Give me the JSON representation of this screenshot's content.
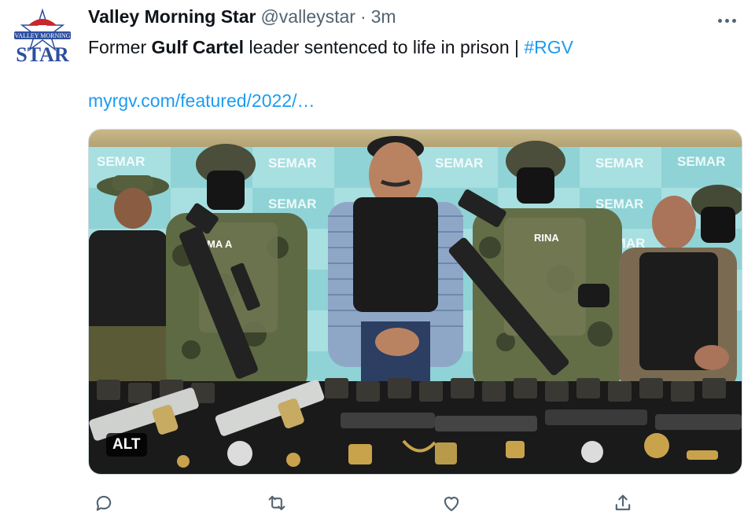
{
  "tweet": {
    "display_name": "Valley Morning Star",
    "handle": "@valleystar",
    "separator": "·",
    "time": "3m",
    "text_before": "Former ",
    "text_bold": "Gulf Cartel",
    "text_after": " leader sentenced to life in prison | ",
    "hashtag": "#RGV",
    "link": "myrgv.com/featured/2022/…",
    "alt_badge": "ALT"
  },
  "avatar": {
    "logo_top": "VALLEY MORNING",
    "logo_main": "STAR"
  },
  "media": {
    "backdrop_text": "SEMAR",
    "vest_text_left": "MA  A",
    "vest_text_right": "RINA"
  },
  "icons": {
    "more": "more-icon",
    "reply": "reply-icon",
    "retweet": "retweet-icon",
    "like": "like-icon",
    "share": "share-icon"
  },
  "colors": {
    "accent": "#1d9bf0",
    "text": "#0f1419",
    "secondary": "#536471",
    "logo_red": "#c8262d",
    "logo_blue": "#2d4f9e"
  }
}
